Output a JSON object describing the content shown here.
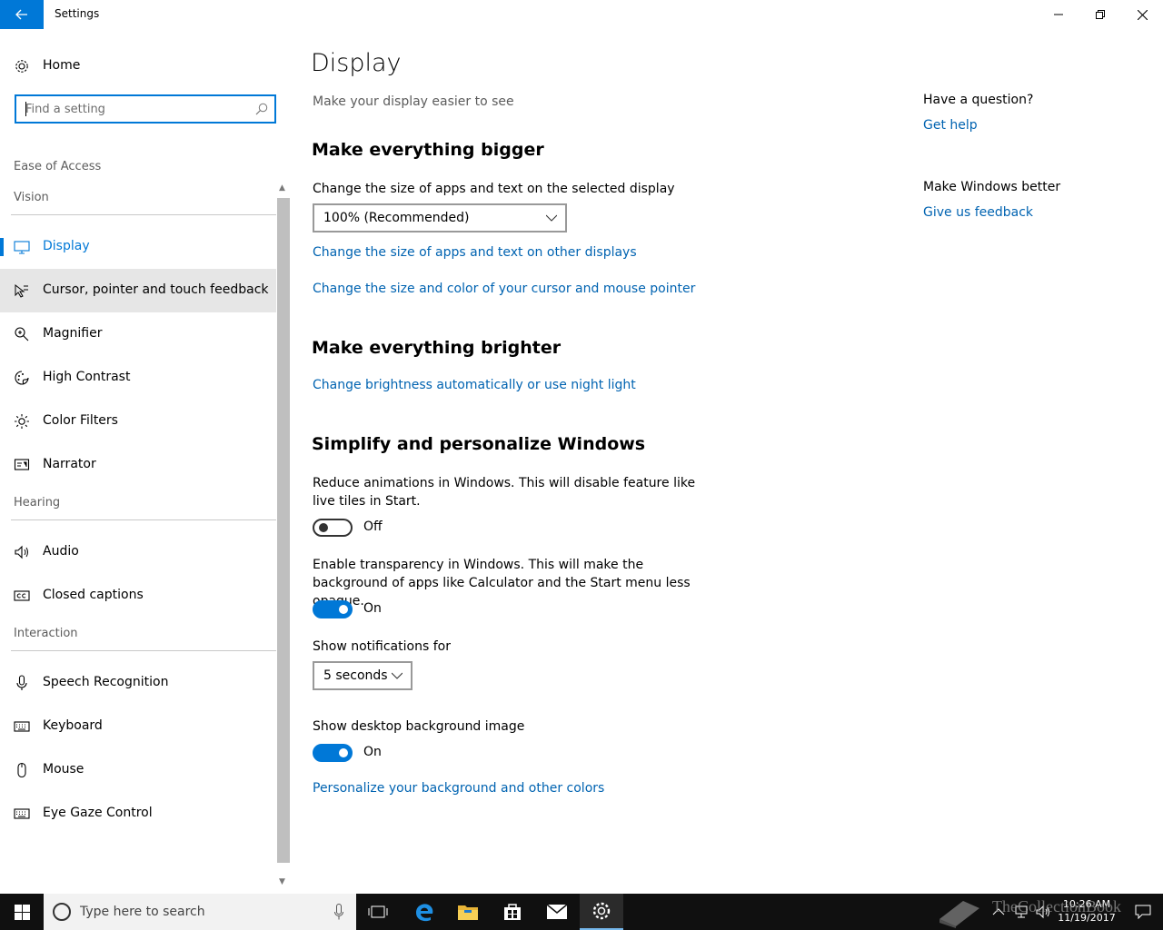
{
  "window": {
    "title": "Settings"
  },
  "sidebar": {
    "home_label": "Home",
    "search_placeholder": "Find a setting",
    "section_title": "Ease of Access",
    "groups": [
      {
        "title": "Vision"
      },
      {
        "title": "Hearing"
      },
      {
        "title": "Interaction"
      }
    ],
    "items": [
      {
        "label": "Display",
        "icon": "monitor-icon",
        "active": true
      },
      {
        "label": "Cursor, pointer and touch feedback",
        "icon": "cursor-icon"
      },
      {
        "label": "Magnifier",
        "icon": "magnifier-icon"
      },
      {
        "label": "High Contrast",
        "icon": "contrast-icon"
      },
      {
        "label": "Color Filters",
        "icon": "brightness-icon"
      },
      {
        "label": "Narrator",
        "icon": "narrator-icon"
      },
      {
        "label": "Audio",
        "icon": "speaker-icon"
      },
      {
        "label": "Closed captions",
        "icon": "captions-icon"
      },
      {
        "label": "Speech Recognition",
        "icon": "microphone-icon"
      },
      {
        "label": "Keyboard",
        "icon": "keyboard-icon"
      },
      {
        "label": "Mouse",
        "icon": "mouse-icon"
      },
      {
        "label": "Eye Gaze Control",
        "icon": "eye-gaze-icon"
      }
    ]
  },
  "main": {
    "title": "Display",
    "subtitle": "Make your display easier to see",
    "bigger": {
      "heading": "Make everything bigger",
      "scale_label": "Change the size of apps and text on the selected display",
      "scale_value": "100% (Recommended)",
      "link_other_displays": "Change the size of apps and text on other displays",
      "link_cursor": "Change the size and color of your cursor and mouse pointer"
    },
    "brighter": {
      "heading": "Make everything brighter",
      "link_brightness": "Change brightness automatically or use night light"
    },
    "simplify": {
      "heading": "Simplify and personalize Windows",
      "animations_label": "Reduce animations in Windows.  This will disable feature like live tiles in Start.",
      "animations_state": "Off",
      "transparency_label": "Enable transparency in Windows.  This will make the background of apps like Calculator and the Start menu less opaque.",
      "transparency_state": "On",
      "notifications_label": "Show notifications for",
      "notifications_value": "5 seconds",
      "background_label": "Show desktop background image",
      "background_state": "On",
      "link_personalize": "Personalize your background and other colors"
    },
    "help": {
      "question": "Have a question?",
      "get_help": "Get help",
      "better": "Make Windows better",
      "feedback": "Give us feedback"
    }
  },
  "taskbar": {
    "search_placeholder": "Type here to search",
    "time": "10:26 AM",
    "date": "11/19/2017",
    "watermark": "TheCollectionBook"
  },
  "colors": {
    "accent": "#0078d7",
    "link": "#0063b1",
    "taskbar": "#101010"
  }
}
